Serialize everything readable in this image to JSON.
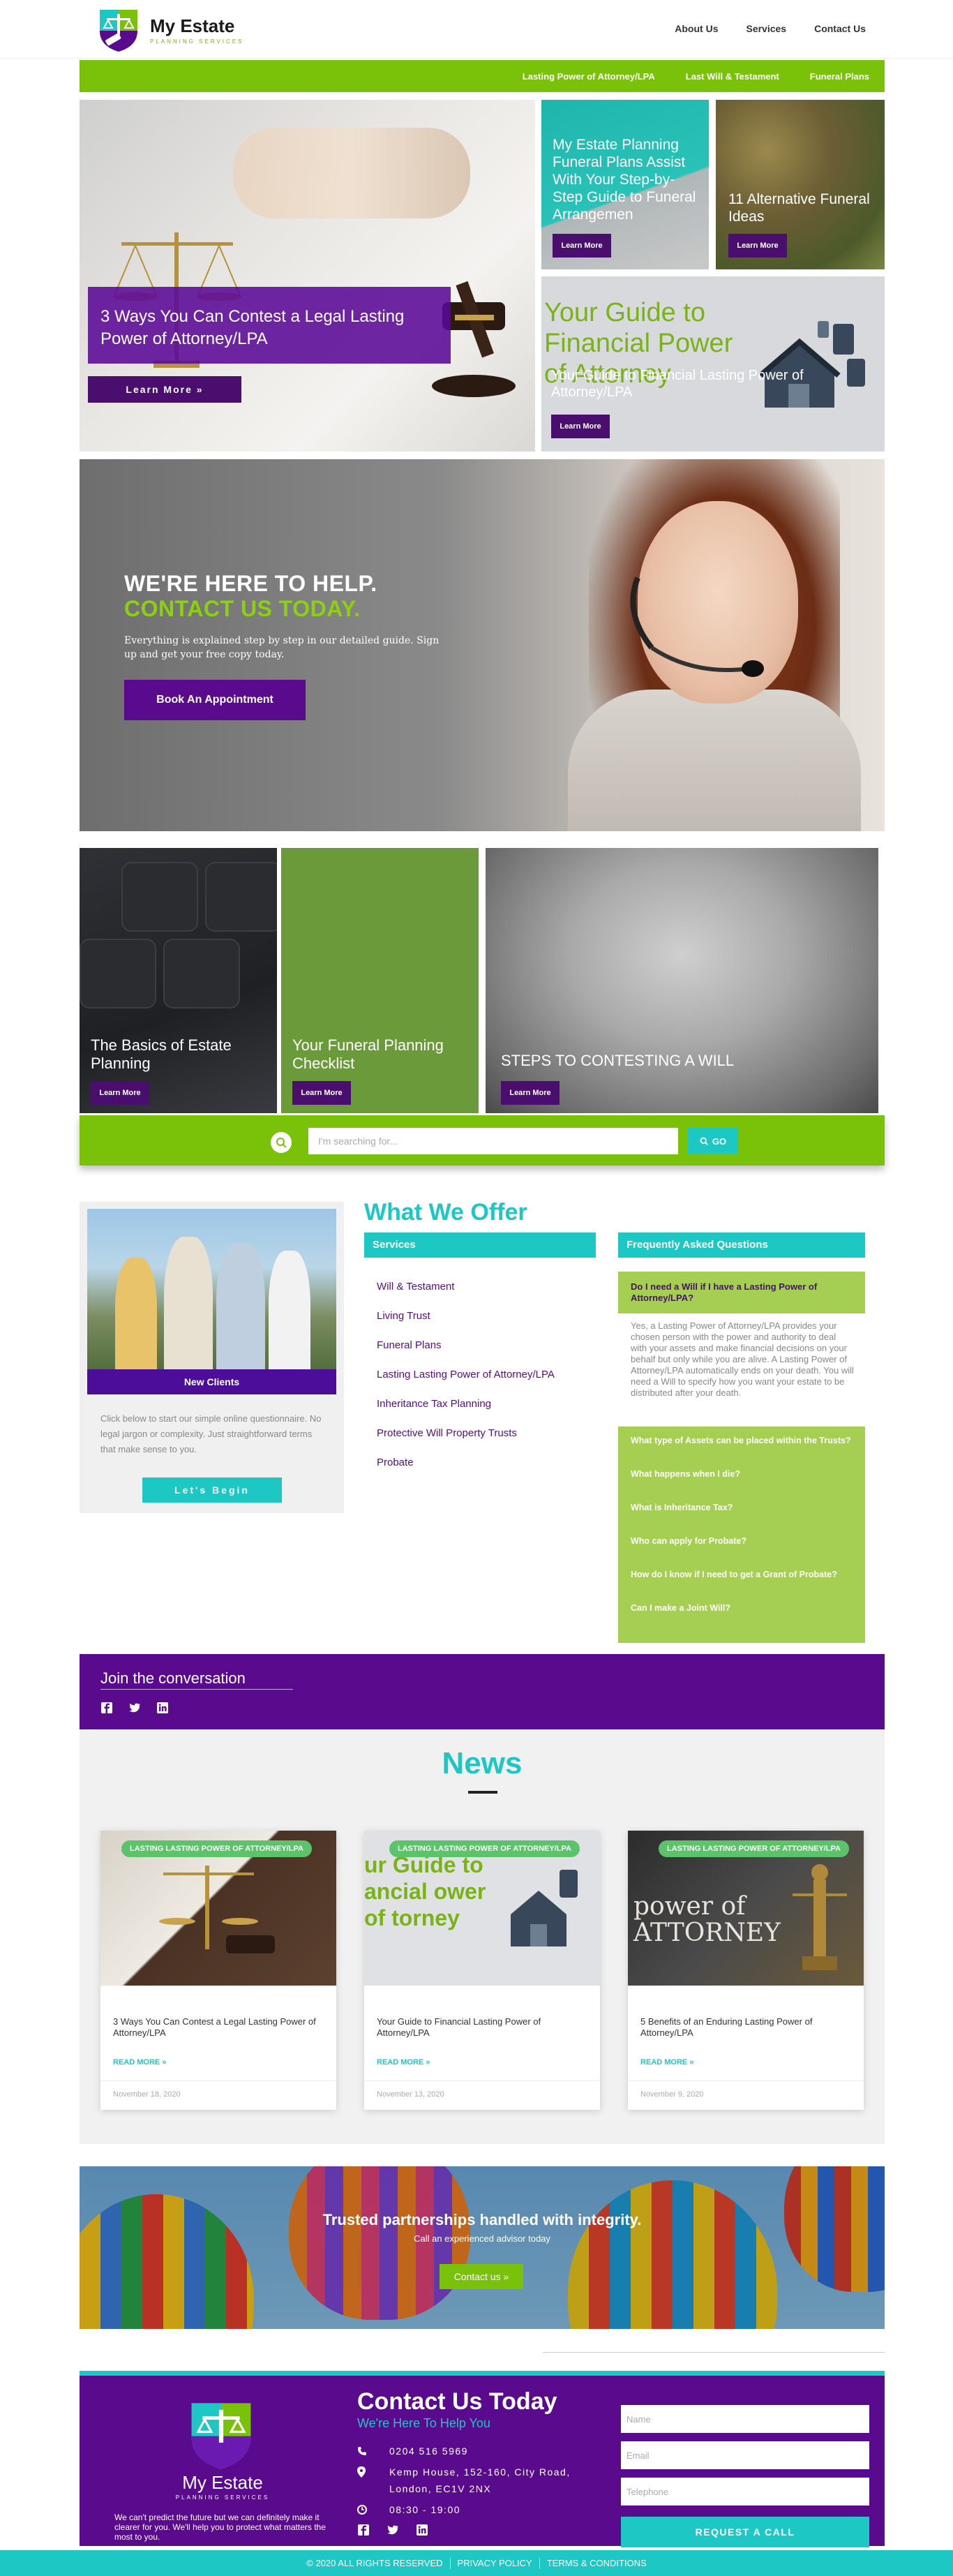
{
  "header": {
    "brand_name": "My Estate",
    "brand_tagline": "PLANNING SERVICES",
    "nav": [
      "About Us",
      "Services",
      "Contact Us"
    ]
  },
  "subnav": [
    "Lasting Power of Attorney/LPA",
    "Last Will & Testament",
    "Funeral Plans"
  ],
  "hero": {
    "main": {
      "title": "3 Ways You Can Contest a Legal Lasting Power of Attorney/LPA",
      "button": "Learn More »"
    },
    "top_right_1": {
      "title": "My Estate Planning Funeral Plans Assist With Your Step-by-Step Guide to Funeral Arrangemen",
      "button": "Learn More"
    },
    "top_right_2": {
      "title": "11 Alternative Funeral Ideas",
      "button": "Learn More"
    },
    "bottom_right": {
      "image_text": "Your Guide to Financial Power of Attorney",
      "title": "Your Guide to Financial Lasting Power of Attorney/LPA",
      "button": "Learn More"
    }
  },
  "cta": {
    "line1": "WE'RE HERE TO HELP.",
    "line2": "CONTACT US TODAY.",
    "text": "Everything is explained step by step in  our detailed guide. Sign up and get your free copy today.",
    "button": "Book An Appointment"
  },
  "tiles": [
    {
      "title": "The Basics of Estate Planning",
      "button": "Learn More"
    },
    {
      "title": "Your Funeral Planning Checklist",
      "button": "Learn More"
    },
    {
      "title": "STEPS TO CONTESTING A WILL",
      "button": "Learn More"
    }
  ],
  "search": {
    "placeholder": "I'm searching for...",
    "button": "GO"
  },
  "new_clients": {
    "label": "New Clients",
    "text": "Click below to start our simple online questionnaire. No legal jargon or complexity. Just straightforward terms that make sense to you.",
    "button": "Let's Begin"
  },
  "offer": {
    "title": "What We Offer",
    "services_heading": "Services",
    "services": [
      "Will & Testament",
      "Living Trust",
      "Funeral Plans",
      "Lasting Lasting Power of Attorney/LPA",
      "Inheritance Tax Planning",
      "Protective Will Property Trusts",
      "Probate"
    ],
    "faq_heading": "Frequently Asked Questions",
    "faq_open": {
      "question": "Do I need a Will if I have a Lasting Power of Attorney/LPA?",
      "answer": "Yes, a Lasting Power of Attorney/LPA provides your chosen person with the power and authority to deal with your assets and make financial decisions on your behalf but only while you are alive. A Lasting Power of Attorney/LPA automatically ends on your death. You will need a Will to specify how you want your estate to be distributed after your death."
    },
    "faq_closed": [
      "What type of Assets can be placed within the Trusts?",
      "What happens when I die?",
      "What is Inheritance Tax?",
      "Who can apply for Probate?",
      "How do I know if I need to get a Grant of Probate?",
      "Can I make a Joint Will?"
    ]
  },
  "join": {
    "title": "Join the conversation"
  },
  "news": {
    "title": "News",
    "cards": [
      {
        "badge": "LASTING LASTING POWER OF ATTORNEY/LPA",
        "title": "3 Ways You Can Contest a Legal Lasting Power of Attorney/LPA",
        "more": "READ MORE »",
        "date": "November 18, 2020"
      },
      {
        "badge": "LASTING LASTING POWER OF ATTORNEY/LPA",
        "image_text": "ur Guide to ancial ower of torney",
        "title": "Your Guide to Financial Lasting Power of Attorney/LPA",
        "more": "READ MORE »",
        "date": "November 13, 2020"
      },
      {
        "badge": "LASTING LASTING POWER OF ATTORNEY/LPA",
        "image_text": "power of ATTORNEY",
        "title": "5 Benefits of an Enduring Lasting Power of Attorney/LPA",
        "more": "READ MORE »",
        "date": "November 9, 2020"
      }
    ]
  },
  "partnership": {
    "title": "Trusted partnerships handled with integrity.",
    "subtitle": "Call an experienced advisor today",
    "button": "Contact us »"
  },
  "footer": {
    "brand_name": "My Estate",
    "brand_tagline": "PLANNING SERVICES",
    "blurb": "We can't predict the future but we can definitely make it clearer for you. We'll help you to protect what matters the most to you.",
    "title": "Contact Us Today",
    "subtitle": "We're Here To Help You",
    "phone": "0204 516 5969",
    "address_line1": "Kemp House, 152-160, City Road,",
    "address_line2": "London, EC1V 2NX",
    "hours": "08:30 - 19:00",
    "form": {
      "name": "Name",
      "email": "Email",
      "telephone": "Telephone",
      "button": "REQUEST A CALL"
    }
  },
  "copyright": {
    "text": "© 2020 ALL RIGHTS RESERVED",
    "privacy": "PRIVACY POLICY",
    "terms": "TERMS & CONDITIONS"
  },
  "colors": {
    "purple": "#5a0a8c",
    "green": "#7ac10a",
    "teal": "#1cc7c4",
    "faq_green": "#a5cf52"
  }
}
